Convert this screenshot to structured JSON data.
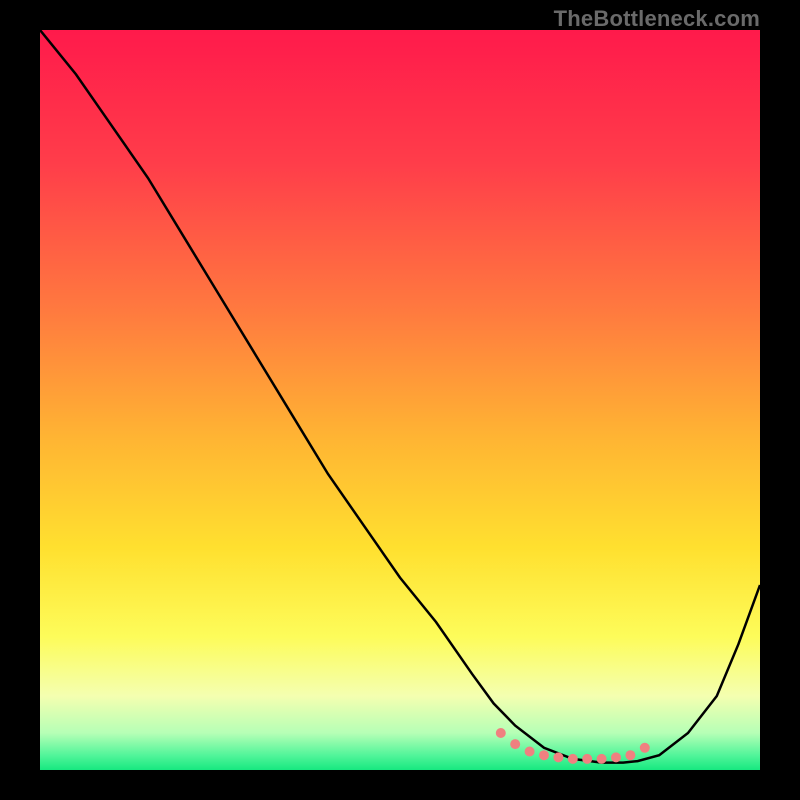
{
  "attribution": "TheBottleneck.com",
  "chart_data": {
    "type": "line",
    "title": "",
    "xlabel": "",
    "ylabel": "",
    "xlim": [
      0,
      100
    ],
    "ylim": [
      0,
      100
    ],
    "gradient_stops": [
      {
        "offset": 0,
        "color": "#ff1a4b"
      },
      {
        "offset": 18,
        "color": "#ff3d4a"
      },
      {
        "offset": 38,
        "color": "#ff7a3f"
      },
      {
        "offset": 55,
        "color": "#ffb433"
      },
      {
        "offset": 70,
        "color": "#ffe02f"
      },
      {
        "offset": 82,
        "color": "#fdfc5a"
      },
      {
        "offset": 90,
        "color": "#f4ffb0"
      },
      {
        "offset": 95,
        "color": "#b6ffb6"
      },
      {
        "offset": 98,
        "color": "#52f59a"
      },
      {
        "offset": 100,
        "color": "#17e880"
      }
    ],
    "series": [
      {
        "name": "bottleneck-curve",
        "color": "#000000",
        "x": [
          0,
          5,
          10,
          15,
          20,
          25,
          30,
          35,
          40,
          45,
          50,
          55,
          60,
          63,
          66,
          70,
          74,
          78,
          81,
          83,
          86,
          90,
          94,
          97,
          100
        ],
        "values": [
          100,
          94,
          87,
          80,
          72,
          64,
          56,
          48,
          40,
          33,
          26,
          20,
          13,
          9,
          6,
          3,
          1.5,
          1,
          1,
          1.2,
          2,
          5,
          10,
          17,
          25
        ]
      },
      {
        "name": "optimal-band-markers",
        "color": "#f08080",
        "type": "scatter",
        "x": [
          64,
          66,
          68,
          70,
          72,
          74,
          76,
          78,
          80,
          82,
          84
        ],
        "values": [
          5,
          3.5,
          2.5,
          2,
          1.7,
          1.5,
          1.5,
          1.5,
          1.7,
          2,
          3
        ]
      }
    ]
  }
}
